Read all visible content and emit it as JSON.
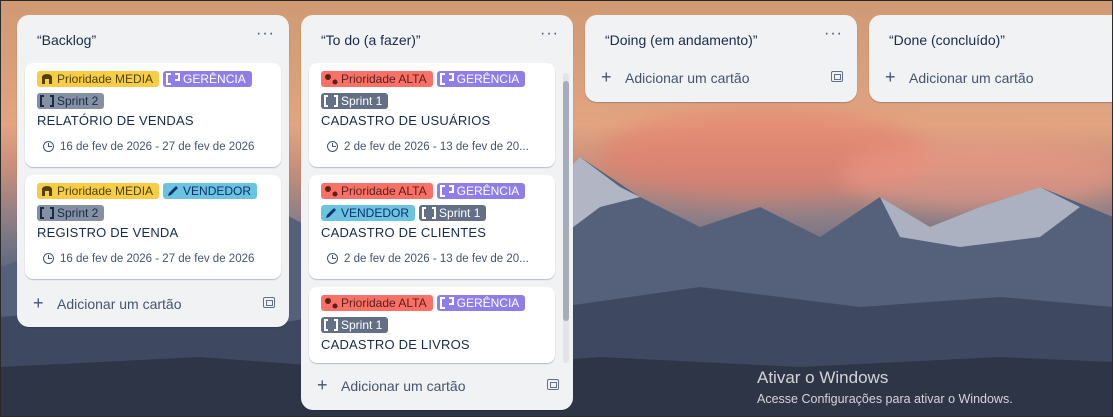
{
  "lists": [
    {
      "title": "“Backlog”",
      "cards": [
        {
          "labels": [
            [
              "Prioridade MEDIA",
              "GERÊNCIA"
            ],
            [
              "Sprint 2"
            ]
          ],
          "title": "RELATÓRIO DE VENDAS",
          "dates": "16 de fev de 2026 - 27 de fev de 2026"
        },
        {
          "labels": [
            [
              "Prioridade MEDIA",
              "VENDEDOR"
            ],
            [
              "Sprint 2"
            ]
          ],
          "title": "REGISTRO DE VENDA",
          "dates": "16 de fev de 2026 - 27 de fev de 2026"
        }
      ],
      "add_card": "Adicionar um cartão"
    },
    {
      "title": "“To do (a fazer)”",
      "cards": [
        {
          "labels": [
            [
              "Prioridade ALTA",
              "GERÊNCIA"
            ],
            [
              "Sprint 1"
            ]
          ],
          "title": "CADASTRO DE USUÁRIOS",
          "dates": "2 de fev de 2026 - 13 de fev de 20..."
        },
        {
          "labels": [
            [
              "Prioridade ALTA",
              "GERÊNCIA"
            ],
            [
              "VENDEDOR",
              "Sprint 1"
            ]
          ],
          "title": "CADASTRO DE CLIENTES",
          "dates": "2 de fev de 2026 - 13 de fev de 20..."
        },
        {
          "labels": [
            [
              "Prioridade ALTA",
              "GERÊNCIA"
            ],
            [
              "Sprint 1"
            ]
          ],
          "title": "CADASTRO DE LIVROS"
        }
      ],
      "add_card": "Adicionar um cartão"
    },
    {
      "title": "“Doing (em andamento)”",
      "add_card": "Adicionar um cartão"
    },
    {
      "title": "“Done (concluído)”",
      "add_card": "Adicionar um cartão"
    }
  ],
  "list_menu_glyph": "···",
  "windows_watermark": {
    "line1": "Ativar o Windows",
    "line2": "Acesse Configurações para ativar o Windows."
  },
  "label_colors": {
    "Prioridade MEDIA": "#f5cd47",
    "Prioridade ALTA": "#f87168",
    "GERÊNCIA": "#8f7ee7",
    "VENDEDOR": "#6cc3e0",
    "Sprint 1": "#626f86",
    "Sprint 2": "#8590a2"
  },
  "label_text_colors": {
    "Prioridade MEDIA": "#533f04",
    "Prioridade ALTA": "#5d1f1a",
    "GERÊNCIA": "#ffffff",
    "VENDEDOR": "#09326c",
    "Sprint 1": "#ffffff",
    "Sprint 2": "#172b4d"
  },
  "label_icons": {
    "Prioridade MEDIA": "arch-icon",
    "Prioridade ALTA": "dots-icon",
    "GERÊNCIA": "bracket-icon",
    "VENDEDOR": "pencil-icon",
    "Sprint 1": "bracket-pair-icon",
    "Sprint 2": "bracket-pair-icon"
  },
  "icons": {
    "add": "plus-icon",
    "template": "template-icon",
    "date": "clock-icon",
    "list_menu": "more-icon"
  }
}
